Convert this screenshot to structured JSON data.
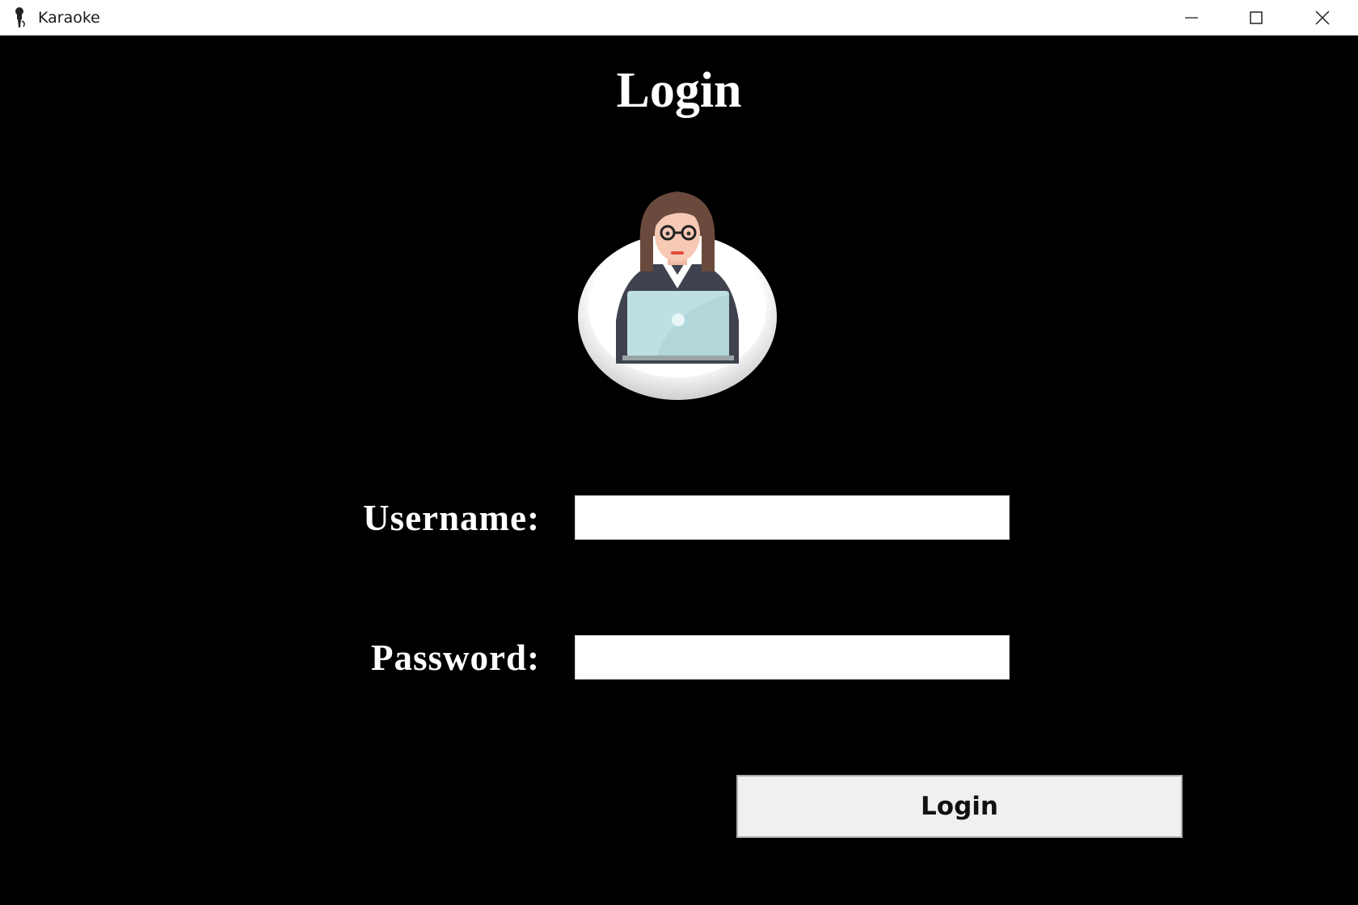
{
  "window": {
    "title": "Karaoke",
    "icon": "microphone-icon",
    "controls": [
      "minimize-icon",
      "maximize-icon",
      "close-icon"
    ]
  },
  "form": {
    "heading": "Login",
    "avatar": "user-avatar-icon",
    "username_label": "Username:",
    "username_value": "",
    "password_label": "Password:",
    "password_value": "",
    "submit_label": "Login"
  },
  "colors": {
    "background": "#000000",
    "text": "#ffffff",
    "button_bg": "#f0f0f0",
    "input_bg": "#ffffff"
  }
}
